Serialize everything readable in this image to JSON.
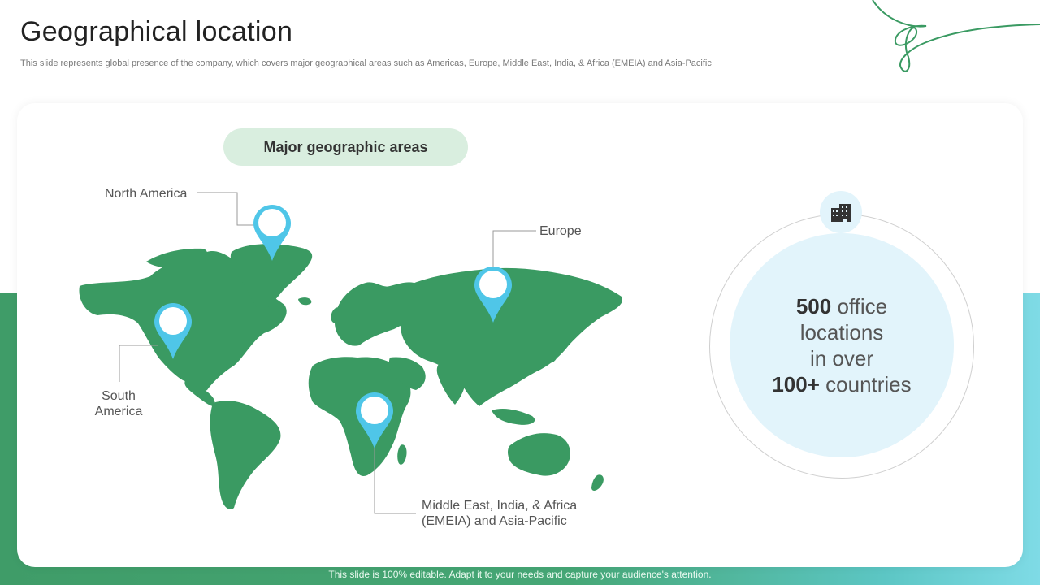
{
  "header": {
    "title": "Geographical location",
    "subtitle": "This slide represents global presence of the company, which covers major geographical areas such as Americas, Europe, Middle East, India, & Africa (EMEIA)  and Asia-Pacific"
  },
  "map_section": {
    "heading": "Major geographic areas",
    "regions": {
      "north_america": "North America",
      "south_america_line1": "South",
      "south_america_line2": "America",
      "europe": "Europe",
      "emeia_line1": "Middle East, India,  & Africa",
      "emeia_line2": "(EMEIA) and Asia-Pacific"
    }
  },
  "stats": {
    "offices_number": "500",
    "offices_text": " office",
    "line2": "locations",
    "line3": "in over",
    "countries_number": "100+",
    "countries_text": " countries",
    "icon": "office-building-icon"
  },
  "footer": {
    "text": "This slide is 100% editable. Adapt it to your needs and capture your audience's attention."
  },
  "colors": {
    "map_green": "#3a9a62",
    "pin_blue": "#4fc6e8",
    "accent_light": "#e2f4fb",
    "pill_bg": "#d9eedf"
  }
}
